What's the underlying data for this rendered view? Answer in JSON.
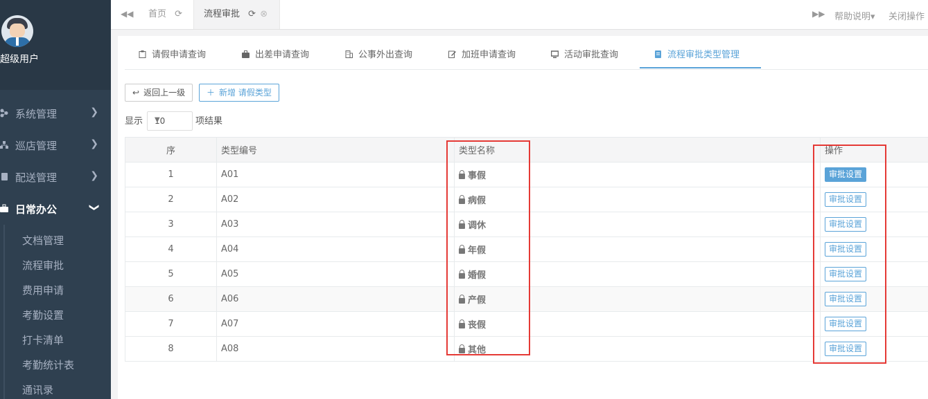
{
  "sidebar": {
    "username": "超级用户",
    "menu": [
      {
        "label": "系统管理",
        "icon": "network-icon"
      },
      {
        "label": "巡店管理",
        "icon": "sitemap-icon"
      },
      {
        "label": "配送管理",
        "icon": "book-icon"
      },
      {
        "label": "日常办公",
        "icon": "briefcase-icon"
      }
    ],
    "submenu": [
      "文档管理",
      "流程审批",
      "费用申请",
      "考勤设置",
      "打卡清单",
      "考勤统计表",
      "通讯录"
    ]
  },
  "topbar": {
    "tabs": [
      {
        "label": "首页"
      },
      {
        "label": "流程审批"
      }
    ],
    "help": "帮助说明",
    "close_ops": "关闭操作"
  },
  "tabs": [
    "请假申请查询",
    "出差申请查询",
    "公事外出查询",
    "加班申请查询",
    "活动审批查询",
    "流程审批类型管理"
  ],
  "actions": {
    "back": "返回上一级",
    "add": "新增 请假类型"
  },
  "show": {
    "prefix": "显示",
    "value": "10",
    "suffix": "项结果"
  },
  "table": {
    "headers": [
      "序",
      "类型编号",
      "类型名称",
      "操作"
    ],
    "rows": [
      {
        "idx": "1",
        "code": "A01",
        "name": "事假",
        "action": "审批设置"
      },
      {
        "idx": "2",
        "code": "A02",
        "name": "病假",
        "action": "审批设置"
      },
      {
        "idx": "3",
        "code": "A03",
        "name": "调休",
        "action": "审批设置"
      },
      {
        "idx": "4",
        "code": "A04",
        "name": "年假",
        "action": "审批设置"
      },
      {
        "idx": "5",
        "code": "A05",
        "name": "婚假",
        "action": "审批设置"
      },
      {
        "idx": "6",
        "code": "A06",
        "name": "产假",
        "action": "审批设置"
      },
      {
        "idx": "7",
        "code": "A07",
        "name": "丧假",
        "action": "审批设置"
      },
      {
        "idx": "8",
        "code": "A08",
        "name": "其他",
        "action": "审批设置"
      }
    ]
  },
  "colors": {
    "sidebar": "#2f4050",
    "accent": "#5aa3d8",
    "highlight": "#e53935"
  }
}
